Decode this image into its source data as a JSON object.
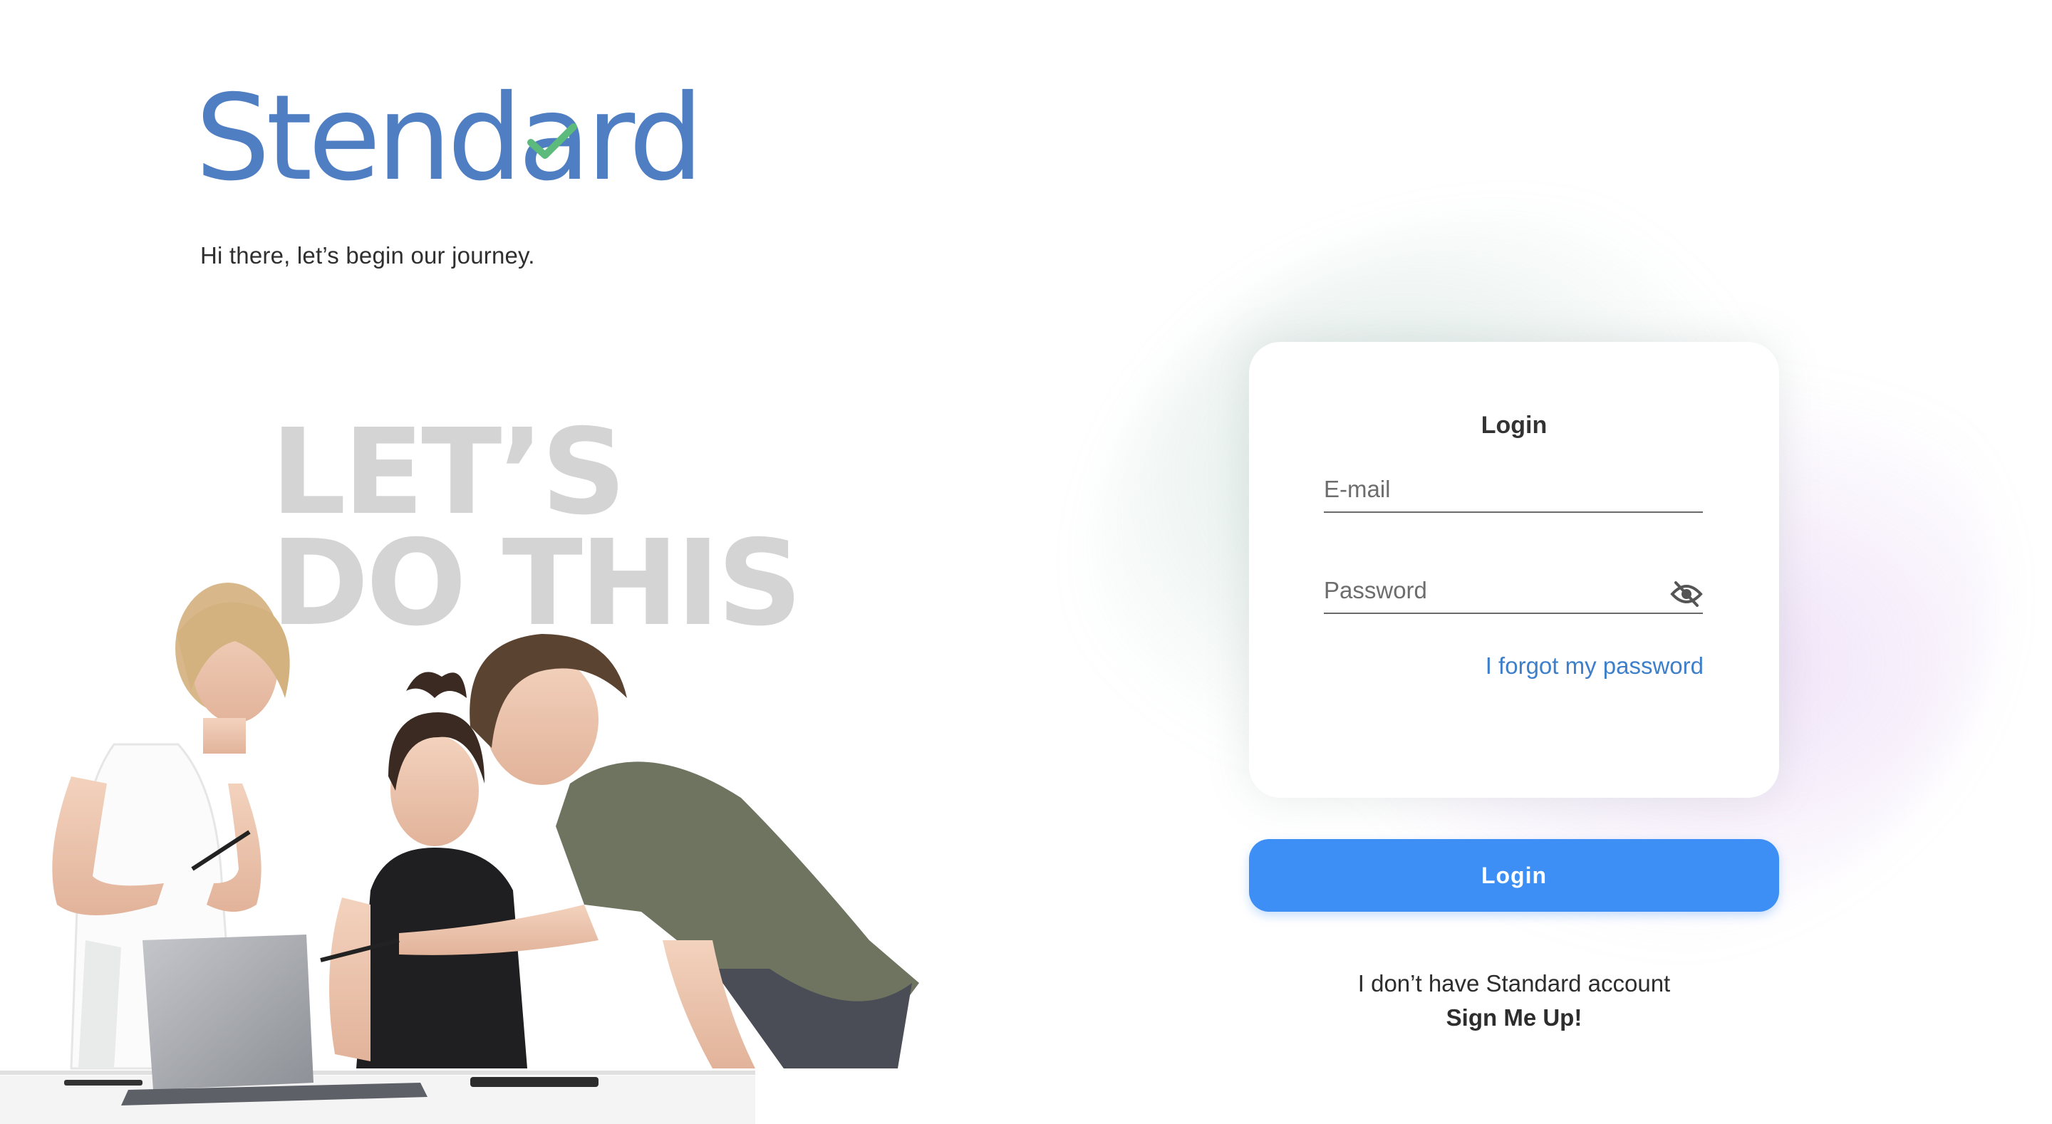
{
  "brand": {
    "logo_before": "Stend",
    "logo_a": "a",
    "logo_after": "rd",
    "logo_color": "#4f7fc2",
    "check_color": "#5cba7d",
    "tagline": "Hi there, let’s begin our journey."
  },
  "hero": {
    "line1": "LET’S",
    "line2": "DO THIS"
  },
  "login_card": {
    "title": "Login",
    "email_placeholder": "E-mail",
    "password_placeholder": "Password",
    "password_toggle_icon": "eye-off-icon",
    "forgot_link": "I forgot my password"
  },
  "actions": {
    "login_button": "Login",
    "button_color": "#3d8ff5",
    "no_account_text": "I don’t have Standard account",
    "signup_link": "Sign Me Up!"
  }
}
